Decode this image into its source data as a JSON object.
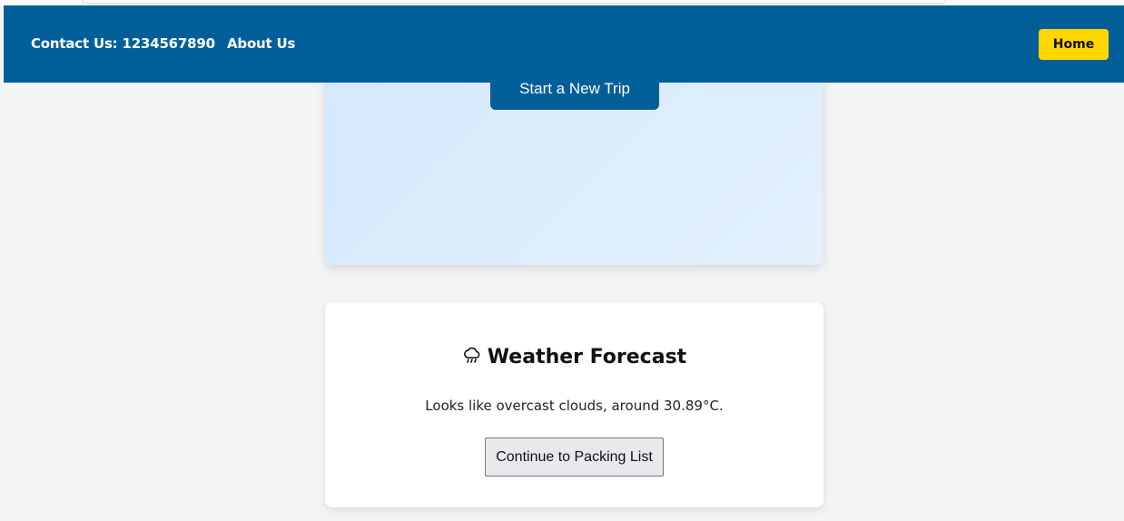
{
  "header": {
    "contact_label": "Contact Us: 1234567890",
    "about_label": "About Us",
    "home_label": "Home",
    "brand_color": "#005f99",
    "home_color": "#ffd700"
  },
  "trip_card": {
    "start_button_label": "Start a New Trip"
  },
  "weather": {
    "icon": "cloud-rain-icon",
    "title": "Weather Forecast",
    "description": "Looks like overcast clouds, around 30.89°C.",
    "continue_button_label": "Continue to Packing List"
  }
}
